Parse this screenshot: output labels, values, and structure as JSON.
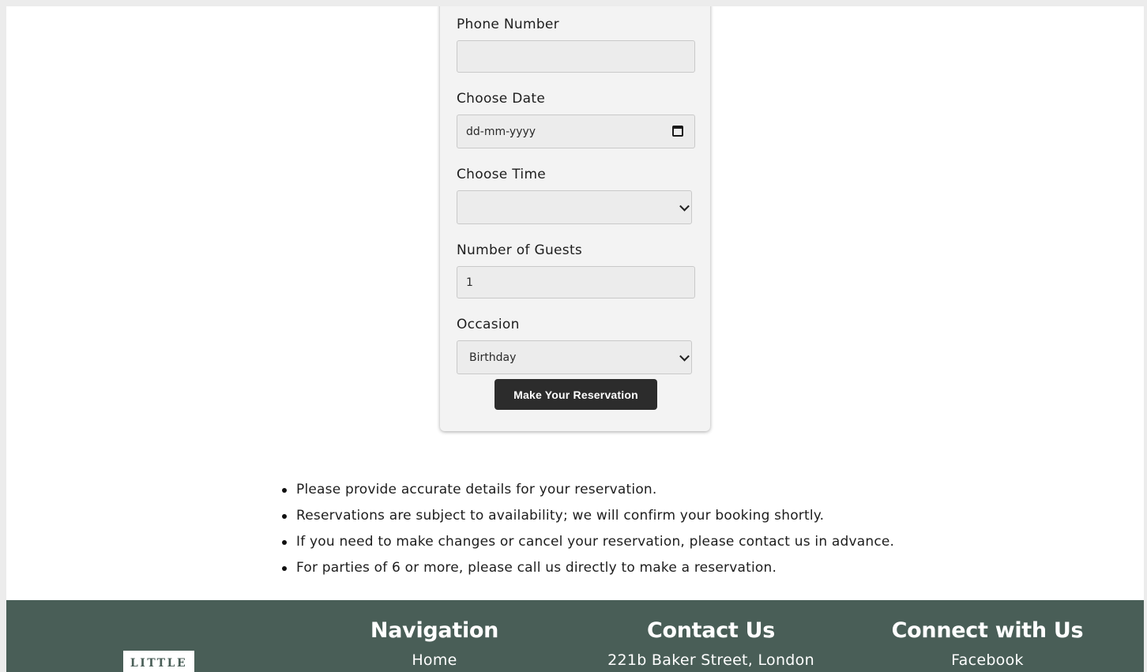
{
  "form": {
    "phone_label": "Phone Number",
    "phone_value": "",
    "date_label": "Choose Date",
    "date_placeholder": "dd-mm-yyyy",
    "time_label": "Choose Time",
    "time_value": "",
    "guests_label": "Number of Guests",
    "guests_value": "1",
    "occasion_label": "Occasion",
    "occasion_value": "Birthday",
    "submit_label": "Make Your Reservation"
  },
  "notes": [
    "Please provide accurate details for your reservation.",
    "Reservations are subject to availability; we will confirm your booking shortly.",
    "If you need to make changes or cancel your reservation, please contact us in advance.",
    "For parties of 6 or more, please call us directly to make a reservation."
  ],
  "footer": {
    "logo_text": "LITTLE",
    "navigation": {
      "heading": "Navigation",
      "items": [
        "Home"
      ]
    },
    "contact": {
      "heading": "Contact Us",
      "items": [
        "221b Baker Street, London"
      ]
    },
    "social": {
      "heading": "Connect with Us",
      "items": [
        "Facebook"
      ]
    }
  },
  "colors": {
    "footer_bg": "#495e57",
    "button_bg": "#2c2c2c",
    "card_bg": "#f3f3f3"
  }
}
